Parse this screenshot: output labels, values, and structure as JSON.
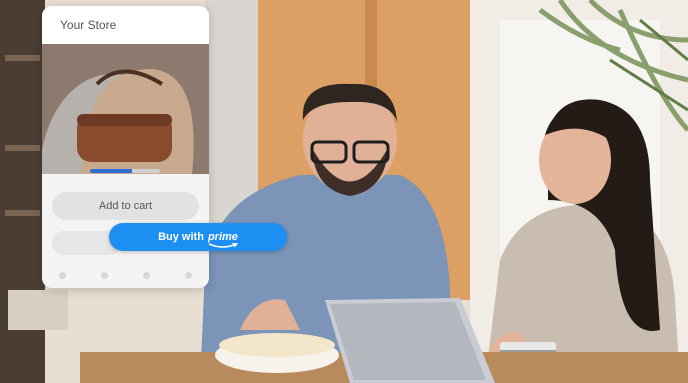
{
  "store": {
    "title": "Your Store",
    "image_progress": 0.6
  },
  "buttons": {
    "add_to_cart": "Add to cart",
    "buy_with": "Buy with",
    "prime": "prime"
  },
  "icons": [
    "home-icon",
    "search-icon",
    "cart-icon",
    "account-icon",
    "prime-smile-icon"
  ],
  "colors": {
    "prime_blue": "#1d8ef2",
    "background": "#e9e1d6"
  }
}
